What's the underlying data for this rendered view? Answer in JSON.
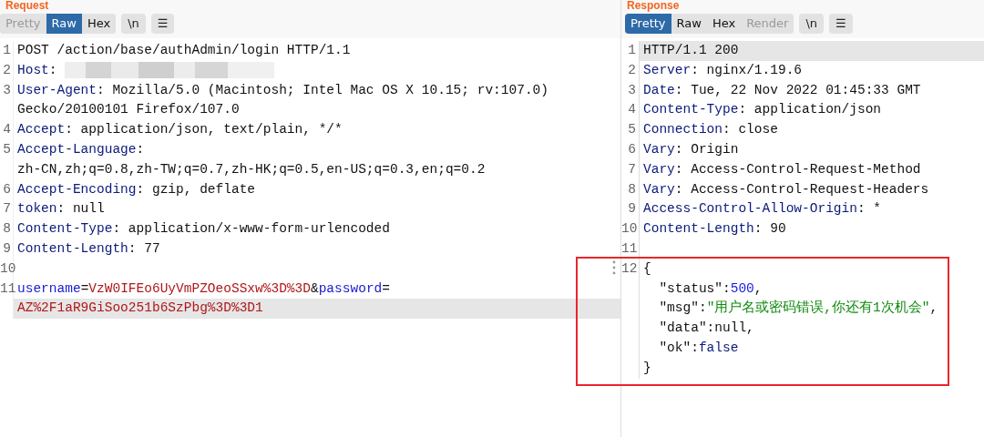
{
  "panels": [
    {
      "title": "Request",
      "tabs": [
        {
          "label": "Pretty",
          "selected": false,
          "disabled": true
        },
        {
          "label": "Raw",
          "selected": true,
          "disabled": false
        },
        {
          "label": "Hex",
          "selected": false,
          "disabled": false
        }
      ],
      "tools": [
        {
          "label": "\\n"
        },
        {
          "label": "☰"
        }
      ],
      "lines": [
        {
          "number": "1",
          "boxed": false,
          "rows": [
            {
              "highlighted": false,
              "segments": [
                {
                  "kind": "plain",
                  "text": "POST /action/base/authAdmin/login HTTP/1.1"
                }
              ]
            }
          ]
        },
        {
          "number": "2",
          "boxed": false,
          "rows": [
            {
              "highlighted": false,
              "segments": [
                {
                  "kind": "header",
                  "text": "Host"
                },
                {
                  "kind": "plain",
                  "text": ":"
                },
                {
                  "kind": "redacted"
                }
              ]
            }
          ]
        },
        {
          "number": "3",
          "boxed": false,
          "rows": [
            {
              "highlighted": false,
              "segments": [
                {
                  "kind": "header",
                  "text": "User-Agent"
                },
                {
                  "kind": "plain",
                  "text": ": Mozilla/5.0 (Macintosh; Intel Mac OS X 10.15; rv:107.0)"
                }
              ]
            },
            {
              "highlighted": false,
              "segments": [
                {
                  "kind": "plain",
                  "text": "Gecko/20100101 Firefox/107.0"
                }
              ]
            }
          ]
        },
        {
          "number": "4",
          "boxed": false,
          "rows": [
            {
              "highlighted": false,
              "segments": [
                {
                  "kind": "header",
                  "text": "Accept"
                },
                {
                  "kind": "plain",
                  "text": ": application/json, text/plain, */*"
                }
              ]
            }
          ]
        },
        {
          "number": "5",
          "boxed": false,
          "rows": [
            {
              "highlighted": false,
              "segments": [
                {
                  "kind": "header",
                  "text": "Accept-Language"
                },
                {
                  "kind": "plain",
                  "text": ":"
                }
              ]
            },
            {
              "highlighted": false,
              "segments": [
                {
                  "kind": "plain",
                  "text": "zh-CN,zh;q=0.8,zh-TW;q=0.7,zh-HK;q=0.5,en-US;q=0.3,en;q=0.2"
                }
              ]
            }
          ]
        },
        {
          "number": "6",
          "boxed": false,
          "rows": [
            {
              "highlighted": false,
              "segments": [
                {
                  "kind": "header",
                  "text": "Accept-Encoding"
                },
                {
                  "kind": "plain",
                  "text": ": gzip, deflate"
                }
              ]
            }
          ]
        },
        {
          "number": "7",
          "boxed": false,
          "rows": [
            {
              "highlighted": false,
              "segments": [
                {
                  "kind": "header",
                  "text": "token"
                },
                {
                  "kind": "plain",
                  "text": ": null"
                }
              ]
            }
          ]
        },
        {
          "number": "8",
          "boxed": false,
          "rows": [
            {
              "highlighted": false,
              "segments": [
                {
                  "kind": "header",
                  "text": "Content-Type"
                },
                {
                  "kind": "plain",
                  "text": ": application/x-www-form-urlencoded"
                }
              ]
            }
          ]
        },
        {
          "number": "9",
          "boxed": false,
          "rows": [
            {
              "highlighted": false,
              "segments": [
                {
                  "kind": "header",
                  "text": "Content-Length"
                },
                {
                  "kind": "plain",
                  "text": ": 77"
                }
              ]
            }
          ]
        },
        {
          "number": "10",
          "boxed": false,
          "rows": [
            {
              "highlighted": false,
              "segments": []
            }
          ]
        },
        {
          "number": "11",
          "boxed": false,
          "rows": [
            {
              "highlighted": false,
              "segments": [
                {
                  "kind": "param",
                  "text": "username"
                },
                {
                  "kind": "plain",
                  "text": "="
                },
                {
                  "kind": "value",
                  "text": "VzW0IFEo6UyVmPZOeoSSxw%3D%3D"
                },
                {
                  "kind": "plain",
                  "text": "&"
                },
                {
                  "kind": "param",
                  "text": "password"
                },
                {
                  "kind": "plain",
                  "text": "="
                }
              ]
            },
            {
              "highlighted": true,
              "segments": [
                {
                  "kind": "value",
                  "text": "AZ%2F1aR9GiSoo251b6SzPbg%3D%3D1"
                }
              ]
            }
          ]
        }
      ]
    },
    {
      "title": "Response",
      "tabs": [
        {
          "label": "Pretty",
          "selected": true,
          "disabled": false
        },
        {
          "label": "Raw",
          "selected": false,
          "disabled": false
        },
        {
          "label": "Hex",
          "selected": false,
          "disabled": false
        },
        {
          "label": "Render",
          "selected": false,
          "disabled": true
        }
      ],
      "tools": [
        {
          "label": "\\n"
        },
        {
          "label": "☰"
        }
      ],
      "lines": [
        {
          "number": "1",
          "boxed": false,
          "rows": [
            {
              "highlighted": true,
              "segments": [
                {
                  "kind": "plain",
                  "text": "HTTP/1.1 200"
                }
              ]
            }
          ]
        },
        {
          "number": "2",
          "boxed": false,
          "rows": [
            {
              "highlighted": false,
              "segments": [
                {
                  "kind": "header",
                  "text": "Server"
                },
                {
                  "kind": "plain",
                  "text": ": nginx/1.19.6"
                }
              ]
            }
          ]
        },
        {
          "number": "3",
          "boxed": false,
          "rows": [
            {
              "highlighted": false,
              "segments": [
                {
                  "kind": "header",
                  "text": "Date"
                },
                {
                  "kind": "plain",
                  "text": ": Tue, 22 Nov 2022 01:45:33 GMT"
                }
              ]
            }
          ]
        },
        {
          "number": "4",
          "boxed": false,
          "rows": [
            {
              "highlighted": false,
              "segments": [
                {
                  "kind": "header",
                  "text": "Content-Type"
                },
                {
                  "kind": "plain",
                  "text": ": application/json"
                }
              ]
            }
          ]
        },
        {
          "number": "5",
          "boxed": false,
          "rows": [
            {
              "highlighted": false,
              "segments": [
                {
                  "kind": "header",
                  "text": "Connection"
                },
                {
                  "kind": "plain",
                  "text": ": close"
                }
              ]
            }
          ]
        },
        {
          "number": "6",
          "boxed": false,
          "rows": [
            {
              "highlighted": false,
              "segments": [
                {
                  "kind": "header",
                  "text": "Vary"
                },
                {
                  "kind": "plain",
                  "text": ": Origin"
                }
              ]
            }
          ]
        },
        {
          "number": "7",
          "boxed": false,
          "rows": [
            {
              "highlighted": false,
              "segments": [
                {
                  "kind": "header",
                  "text": "Vary"
                },
                {
                  "kind": "plain",
                  "text": ": Access-Control-Request-Method"
                }
              ]
            }
          ]
        },
        {
          "number": "8",
          "boxed": false,
          "rows": [
            {
              "highlighted": false,
              "segments": [
                {
                  "kind": "header",
                  "text": "Vary"
                },
                {
                  "kind": "plain",
                  "text": ": Access-Control-Request-Headers"
                }
              ]
            }
          ]
        },
        {
          "number": "9",
          "boxed": false,
          "rows": [
            {
              "highlighted": false,
              "segments": [
                {
                  "kind": "header",
                  "text": "Access-Control-Allow-Origin"
                },
                {
                  "kind": "plain",
                  "text": ": *"
                }
              ]
            }
          ]
        },
        {
          "number": "10",
          "boxed": false,
          "rows": [
            {
              "highlighted": false,
              "segments": [
                {
                  "kind": "header",
                  "text": "Content-Length"
                },
                {
                  "kind": "plain",
                  "text": ": 90"
                }
              ]
            }
          ]
        },
        {
          "number": "11",
          "boxed": false,
          "rows": [
            {
              "highlighted": false,
              "segments": []
            }
          ]
        },
        {
          "number": "12",
          "boxed": true,
          "rows": [
            {
              "highlighted": false,
              "segments": [
                {
                  "kind": "plain",
                  "text": "{"
                }
              ]
            },
            {
              "highlighted": false,
              "segments": [
                {
                  "kind": "plain",
                  "text": "  \"status\":"
                },
                {
                  "kind": "number",
                  "text": "500"
                },
                {
                  "kind": "plain",
                  "text": ","
                }
              ]
            },
            {
              "highlighted": false,
              "segments": [
                {
                  "kind": "plain",
                  "text": "  \"msg\":"
                },
                {
                  "kind": "string",
                  "text": "\"用户名或密码错误,你还有1次机会\""
                },
                {
                  "kind": "plain",
                  "text": ","
                }
              ]
            },
            {
              "highlighted": false,
              "segments": [
                {
                  "kind": "plain",
                  "text": "  \"data\":null,"
                }
              ]
            },
            {
              "highlighted": false,
              "segments": [
                {
                  "kind": "plain",
                  "text": "  \"ok\":"
                },
                {
                  "kind": "keyword",
                  "text": "false"
                }
              ]
            },
            {
              "highlighted": false,
              "segments": [
                {
                  "kind": "plain",
                  "text": "}"
                }
              ]
            }
          ]
        }
      ]
    }
  ]
}
